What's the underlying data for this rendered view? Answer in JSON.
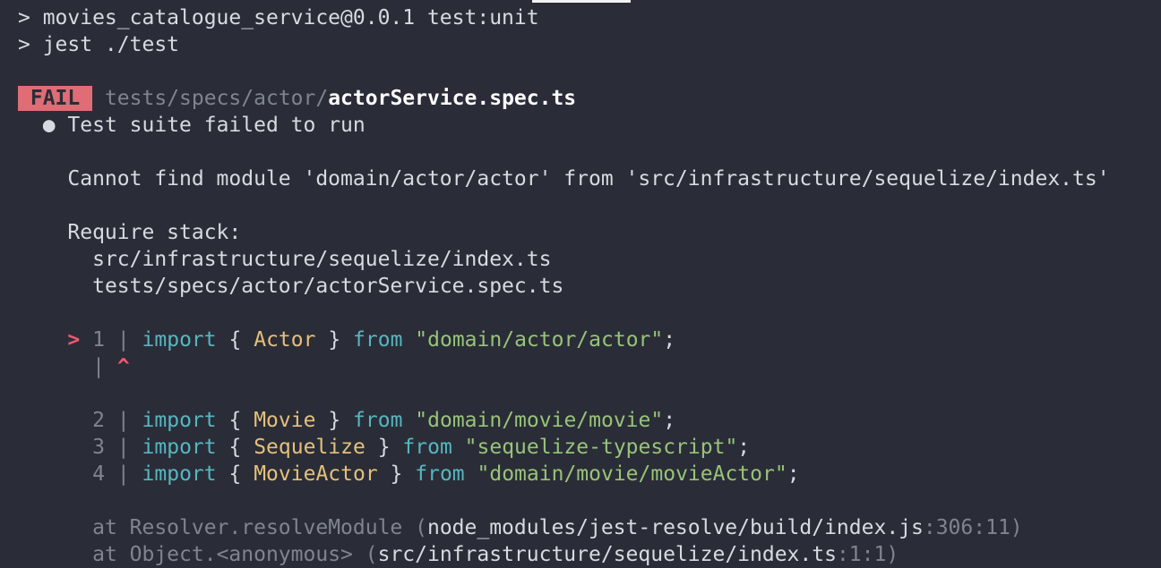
{
  "npm": {
    "line1": "> movies_catalogue_service@0.0.1 test:unit",
    "line2": "> jest ./test"
  },
  "result": {
    "badge": " FAIL ",
    "path_dir": "tests/specs/actor/",
    "path_file": "actorService.spec.ts"
  },
  "suite": {
    "bullet": "●",
    "message": "Test suite failed to run"
  },
  "error": {
    "message": "Cannot find module 'domain/actor/actor' from 'src/infrastructure/sequelize/index.ts'",
    "require_title": "Require stack:",
    "require_stack": [
      "src/infrastructure/sequelize/index.ts",
      "tests/specs/actor/actorService.spec.ts"
    ]
  },
  "code_frame": {
    "pointer": ">",
    "caret": "^",
    "separator": "|",
    "lines": [
      {
        "num": "1",
        "kw": "import",
        "open": "{",
        "name": "Actor",
        "close": "}",
        "from": "from",
        "source": "\"domain/actor/actor\"",
        "end": ";"
      },
      {
        "num": "2",
        "kw": "import",
        "open": "{",
        "name": "Movie",
        "close": "}",
        "from": "from",
        "source": "\"domain/movie/movie\"",
        "end": ";"
      },
      {
        "num": "3",
        "kw": "import",
        "open": "{",
        "name": "Sequelize",
        "close": "}",
        "from": "from",
        "source": "\"sequelize-typescript\"",
        "end": ";"
      },
      {
        "num": "4",
        "kw": "import",
        "open": "{",
        "name": "MovieActor",
        "close": "}",
        "from": "from",
        "source": "\"domain/movie/movieActor\"",
        "end": ";"
      }
    ]
  },
  "stack_trace": [
    {
      "prefix": "at Resolver.resolveModule (",
      "file": "node_modules/jest-resolve/build/index.js",
      "pos": ":306:11",
      "suffix": ")"
    },
    {
      "prefix": "at Object.<anonymous> (",
      "file": "src/infrastructure/sequelize/index.ts",
      "pos": ":1:1",
      "suffix": ")"
    }
  ],
  "colors": {
    "background": "#2a2d37",
    "fail_badge": "#e06c75",
    "keyword": "#56b6c2",
    "identifier": "#e5c07b",
    "string": "#98c379",
    "error_pointer": "#ef596f",
    "dim": "#7f848e"
  }
}
